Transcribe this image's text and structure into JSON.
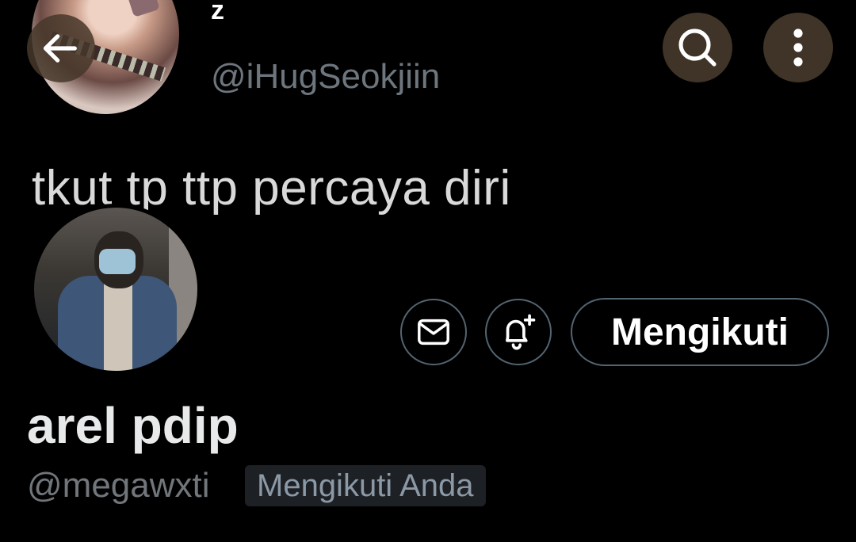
{
  "banner": {
    "name": "z",
    "handle": "@iHugSeokjiin",
    "tweet_text": "tkut tp ttp percaya diri"
  },
  "header_icons": {
    "back": "arrow-left-icon",
    "search": "search-icon",
    "more": "more-vertical-icon"
  },
  "actions": {
    "message_icon": "mail-icon",
    "notify_icon": "bell-plus-icon",
    "follow_label": "Mengikuti"
  },
  "profile": {
    "display_name": "arel pdip",
    "handle": "@megawxti",
    "follows_you_badge": "Mengikuti Anda"
  },
  "colors": {
    "background": "#000000",
    "header_button_bg": "#3f3427",
    "outline": "#536471",
    "muted_text": "#71767b"
  }
}
